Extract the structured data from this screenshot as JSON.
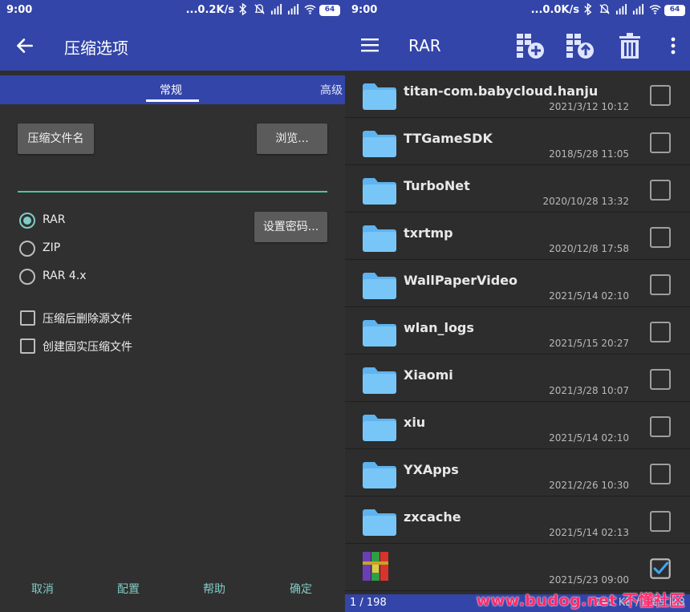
{
  "left_status": {
    "time": "9:00",
    "net": "...0.2K/s",
    "battery": "64"
  },
  "right_status": {
    "time": "9:00",
    "net": "...0.0K/s",
    "battery": "64"
  },
  "left": {
    "title": "压缩选项",
    "tabs": [
      "常规",
      "高级"
    ],
    "archive_name_button": "压缩文件名",
    "browse_button": "浏览...",
    "set_password_button": "设置密码...",
    "formats": [
      "RAR",
      "ZIP",
      "RAR 4.x"
    ],
    "selected_format": "RAR",
    "options": [
      "压缩后删除源文件",
      "创建固实压缩文件"
    ],
    "footer": [
      "取消",
      "配置",
      "帮助",
      "确定"
    ],
    "accent": "#80cbc4",
    "bar_color": "#3345a8"
  },
  "right": {
    "title": "RAR",
    "toolbar_icons": [
      "add-to-archive-icon",
      "extract-icon",
      "delete-icon",
      "more-vert-icon"
    ],
    "files": [
      {
        "name": "titan-com.babycloud.hanju",
        "date": "2021/3/12 10:12",
        "checked": false
      },
      {
        "name": "TTGameSDK",
        "date": "2018/5/28 11:05",
        "checked": false
      },
      {
        "name": "TurboNet",
        "date": "2020/10/28 13:32",
        "checked": false
      },
      {
        "name": "txrtmp",
        "date": "2020/12/8 17:58",
        "checked": false
      },
      {
        "name": "WallPaperVideo",
        "date": "2021/5/14 02:10",
        "checked": false
      },
      {
        "name": "wlan_logs",
        "date": "2021/5/15 20:27",
        "checked": false
      },
      {
        "name": "Xiaomi",
        "date": "2021/3/28 10:07",
        "checked": false
      },
      {
        "name": "xiu",
        "date": "2021/5/14 02:10",
        "checked": false
      },
      {
        "name": "YXApps",
        "date": "2021/2/26 10:30",
        "checked": false
      },
      {
        "name": "zxcache",
        "date": "2021/5/14 02:13",
        "checked": false
      }
    ],
    "last_file": {
      "date": "2021/5/23 09:00",
      "checked": true
    },
    "page_count": "1 / 198",
    "size_info": "245 KB / 4.89 MB"
  },
  "watermark": "www.budog.net 不懂社区"
}
